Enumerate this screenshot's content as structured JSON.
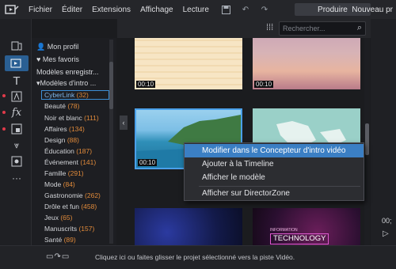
{
  "menu": {
    "items": [
      "Fichier",
      "Éditer",
      "Extensions",
      "Affichage",
      "Lecture"
    ],
    "produce_label": "Produire",
    "new_label": "Nouveau pr"
  },
  "sidebar": {
    "profile": "Mon profil",
    "favorites": "Mes favoris",
    "saved_models": "Modèles enregistr...",
    "intro_models": "▾Modèles d'intro ...",
    "categories": [
      {
        "name": "CyberLink",
        "count": "(32)"
      },
      {
        "name": "Beauté",
        "count": "(78)"
      },
      {
        "name": "Noir et blanc",
        "count": "(111)"
      },
      {
        "name": "Affaires",
        "count": "(134)"
      },
      {
        "name": "Design",
        "count": "(88)"
      },
      {
        "name": "Éducation",
        "count": "(187)"
      },
      {
        "name": "Événement",
        "count": "(141)"
      },
      {
        "name": "Famille",
        "count": "(291)"
      },
      {
        "name": "Mode",
        "count": "(84)"
      },
      {
        "name": "Gastronomie",
        "count": "(262)"
      },
      {
        "name": "Drôle et fun",
        "count": "(458)"
      },
      {
        "name": "Jeux",
        "count": "(65)"
      },
      {
        "name": "Manuscrits",
        "count": "(157)"
      },
      {
        "name": "Santé",
        "count": "(89)"
      }
    ]
  },
  "search": {
    "placeholder": "Rechercher..."
  },
  "thumbnails": [
    {
      "duration": "00:10"
    },
    {
      "duration": "00:10"
    },
    {
      "duration": "00:10"
    },
    {
      "duration": ""
    },
    {
      "duration": ""
    },
    {
      "duration": "",
      "text1": "INFORMATION",
      "text2": "TECHNOLOGY"
    }
  ],
  "context_menu": {
    "items": [
      "Modifier dans le Concepteur d'intro vidéo",
      "Ajouter à la Timeline",
      "Afficher le modèle",
      "Afficher sur DirectorZone"
    ]
  },
  "status": {
    "hint": "Cliquez ici ou faites glisser le projet sélectionné vers la piste Vidéo.",
    "time_fragment": "00;"
  },
  "colors": {
    "accent": "#3b7fc4",
    "count": "#e08a3a"
  }
}
